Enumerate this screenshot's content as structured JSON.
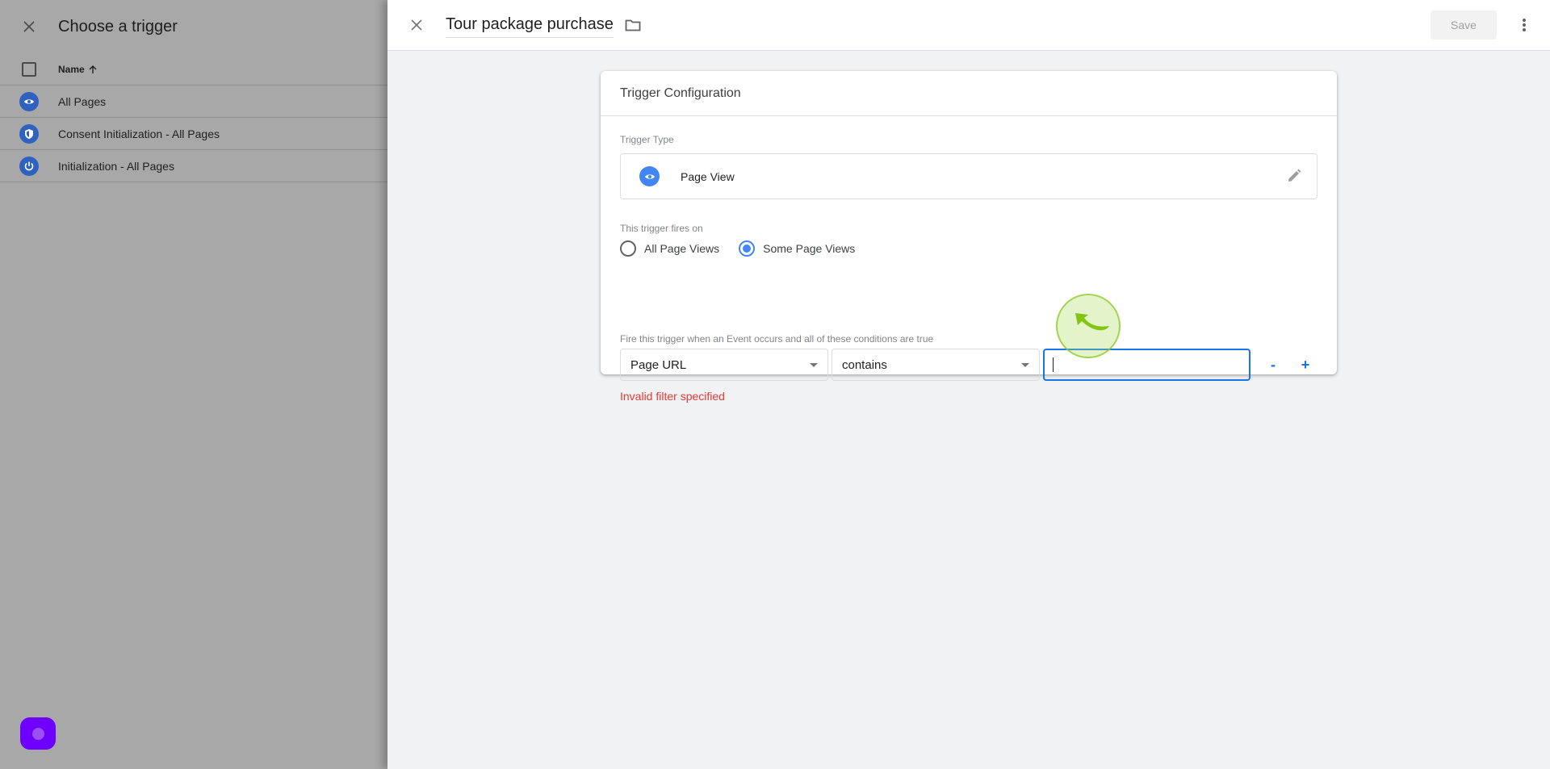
{
  "chooser": {
    "title": "Choose a trigger",
    "column_name": "Name",
    "sort_icon": "arrow-up-icon",
    "rows": [
      {
        "label": "All Pages",
        "icon": "eye-icon"
      },
      {
        "label": "Consent Initialization - All Pages",
        "icon": "shield-icon"
      },
      {
        "label": "Initialization - All Pages",
        "icon": "power-icon"
      }
    ]
  },
  "editor": {
    "title": "Tour package purchase",
    "save_label": "Save",
    "card_title": "Trigger Configuration",
    "trigger_type_label": "Trigger Type",
    "trigger_type": "Page View",
    "fires_on_label": "This trigger fires on",
    "fires_on_options": [
      {
        "label": "All Page Views",
        "selected": false
      },
      {
        "label": "Some Page Views",
        "selected": true
      }
    ],
    "condition_label": "Fire this trigger when an Event occurs and all of these conditions are true",
    "condition": {
      "variable": "Page URL",
      "operator": "contains",
      "value": ""
    },
    "remove_label": "-",
    "add_label": "+",
    "error": "Invalid filter specified"
  },
  "colors": {
    "accent": "#1a73e8",
    "icon_blue": "#4285f4",
    "error": "#e53935",
    "fab": "#6f00ff"
  }
}
